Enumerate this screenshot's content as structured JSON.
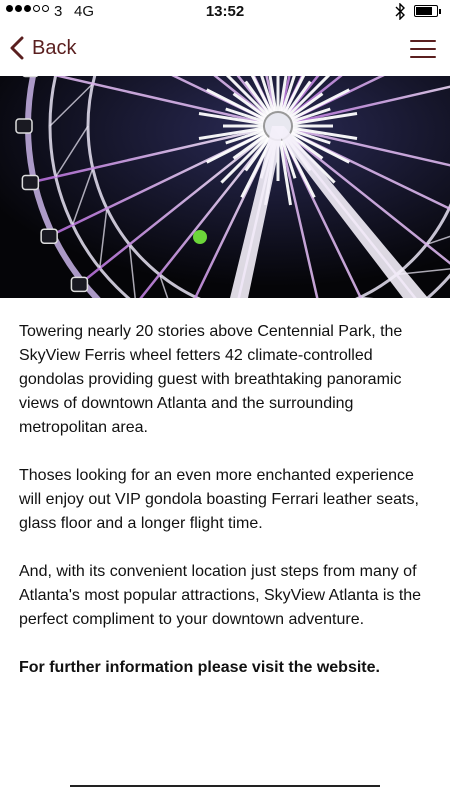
{
  "status_bar": {
    "carrier": "3",
    "network": "4G",
    "time": "13:52",
    "battery_level": 0.8
  },
  "nav": {
    "back_label": "Back",
    "accent_color": "#5a1f1f"
  },
  "content": {
    "paragraphs": [
      "Towering nearly 20 stories above Centennial Park, the SkyView Ferris wheel fetters 42 climate-controlled gondolas providing guest with breathtaking panoramic views of downtown Atlanta and the surrounding metropolitan area.",
      "Thoses looking for an even more enchanted experience will enjoy out VIP gondola boasting Ferrari leather seats, glass floor and a longer flight time.",
      "And, with its convenient location just steps from many of Atlanta's most popular attractions, SkyView Atlanta is the perfect compliment to your downtown adventure."
    ],
    "info_text": "For further information please visit the website."
  }
}
